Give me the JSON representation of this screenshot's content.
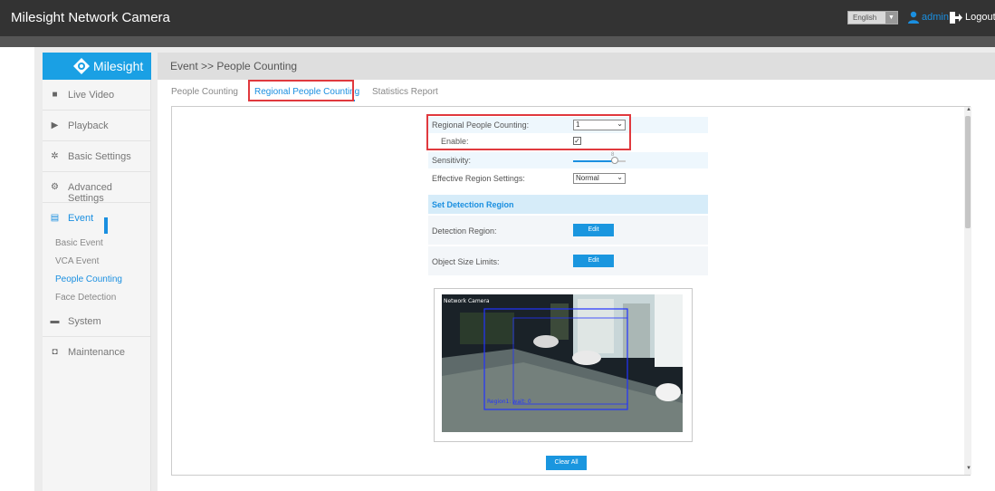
{
  "app": {
    "title": "Milesight Network Camera",
    "language": "English",
    "user": "admin",
    "logout": "Logout"
  },
  "brand": {
    "logo_text": "Milesight",
    "accent": "#1a8fe0",
    "highlight_color": "#e0393e"
  },
  "sidebar": {
    "items": [
      {
        "label": "Live Video",
        "icon": "video-camera-icon"
      },
      {
        "label": "Playback",
        "icon": "playback-icon"
      },
      {
        "label": "Basic Settings",
        "icon": "gear-icon"
      },
      {
        "label": "Advanced Settings",
        "icon": "gears-icon"
      },
      {
        "label": "Event",
        "icon": "event-icon"
      },
      {
        "label": "System",
        "icon": "monitor-icon"
      },
      {
        "label": "Maintenance",
        "icon": "toolbox-icon"
      }
    ],
    "event_sub": [
      "Basic Event",
      "VCA Event",
      "People Counting",
      "Face Detection"
    ]
  },
  "header": {
    "breadcrumb": "Event >> People Counting"
  },
  "tabs": [
    {
      "label": "People Counting"
    },
    {
      "label": "Regional People Counting"
    },
    {
      "label": "Statistics Report"
    }
  ],
  "form": {
    "regional_label": "Regional People Counting:",
    "regional_value": "1",
    "enable_label": "Enable:",
    "enable_checked": "✓",
    "sensitivity_label": "Sensitivity:",
    "sensitivity_value": "8",
    "sensitivity_fraction": 0.8,
    "effective_label": "Effective Region Settings:",
    "effective_value": "Normal",
    "section_title": "Set Detection Region",
    "detection_label": "Detection Region:",
    "object_label": "Object Size Limits:",
    "edit_label": "Edit",
    "clear_label": "Clear All"
  },
  "video": {
    "osd_left": "Network Camera",
    "region_label": "Region1: wait: 0"
  }
}
